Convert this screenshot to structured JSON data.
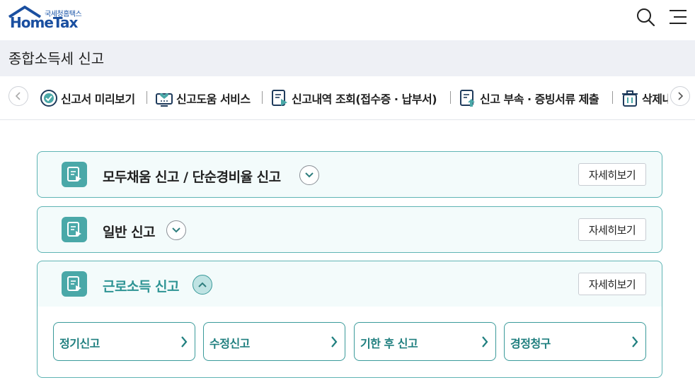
{
  "header": {
    "logo_sub": "국세청홈택스",
    "logo_main": "HomeTax"
  },
  "title": "종합소득세 신고",
  "toolbar": {
    "items": [
      {
        "label": "신고서 미리보기",
        "icon": "check-badge-icon"
      },
      {
        "label": "신고도움 서비스",
        "icon": "heart-monitor-icon"
      },
      {
        "label": "신고내역 조회(접수증 · 납부서)",
        "icon": "document-play-icon"
      },
      {
        "label": "신고 부속 · 증빙서류 제출",
        "icon": "document-upload-icon"
      },
      {
        "label": "삭제내",
        "icon": "trash-icon"
      }
    ]
  },
  "sections": [
    {
      "title": "모두채움 신고 / 단순경비율 신고",
      "detail": "자세히보기",
      "expanded": false
    },
    {
      "title": "일반 신고",
      "detail": "자세히보기",
      "expanded": false
    },
    {
      "title": "근로소득 신고",
      "detail": "자세히보기",
      "expanded": true,
      "subitems": [
        "정기신고",
        "수정신고",
        "기한 후 신고",
        "경정청구"
      ]
    }
  ],
  "colors": {
    "accent": "#4aa8a8",
    "brand": "#1a4fa0",
    "border": "#5fb4b4",
    "active_text": "#2e9494"
  }
}
